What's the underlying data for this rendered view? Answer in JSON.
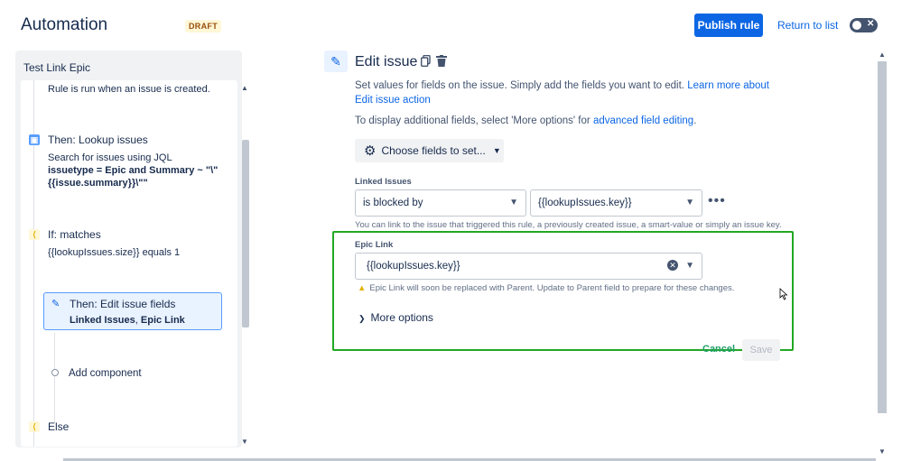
{
  "header": {
    "title": "Automation",
    "status_badge": "DRAFT",
    "publish_label": "Publish rule",
    "return_label": "Return to list",
    "toggle_symbol": "✕"
  },
  "rule": {
    "name": "Test Link Epic",
    "trigger_desc": "Rule is run when an issue is created.",
    "lookup": {
      "heading": "Then: Lookup issues",
      "line1": "Search for issues using JQL",
      "line2": "issuetype = Epic and Summary ~ \"\\\"",
      "line3": "{{issue.summary}}\\\"\""
    },
    "condition": {
      "heading": "If: matches",
      "line1": "{{lookupIssues.size}} equals 1"
    },
    "selected_step": {
      "heading": "Then: Edit issue fields",
      "fields": "Linked Issues",
      "sep": ", ",
      "fields2": "Epic Link"
    },
    "add_component": "Add component",
    "else_label": "Else"
  },
  "editor": {
    "title": "Edit issue",
    "description": "Set values for fields on the issue. Simply add the fields you want to edit.",
    "learn_more": "Learn more about Edit issue action",
    "additional_prefix": "To display additional fields, select 'More options' for",
    "additional_link": "advanced field editing",
    "additional_suffix": ".",
    "choose_fields": "Choose fields to set...",
    "linked_issues": {
      "label": "Linked Issues",
      "relation": "is blocked by",
      "value": "{{lookupIssues.key}}",
      "more": "•••",
      "helper": "You can link to the issue that triggered this rule, a previously created issue, a smart-value or simply an issue key."
    },
    "epic_link": {
      "label": "Epic Link",
      "value": "{{lookupIssues.key}}",
      "warning": "Epic Link will soon be replaced with Parent. Update to Parent field to prepare for these changes."
    },
    "more_options": "More options",
    "cancel": "Cancel",
    "save": "Save"
  },
  "colors": {
    "accent": "#0c66e4",
    "highlight_border": "#22a822",
    "warning": "#e2b203"
  }
}
